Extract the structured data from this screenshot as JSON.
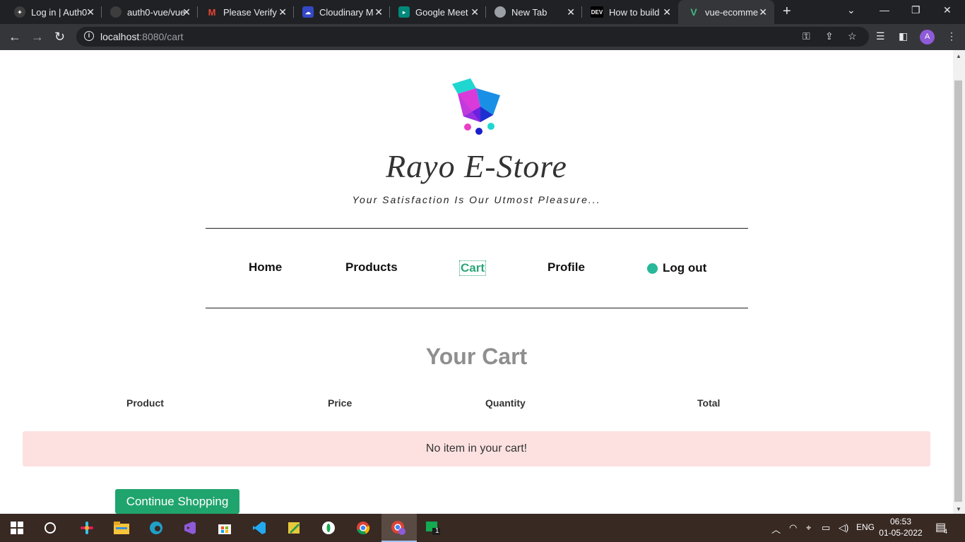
{
  "browser": {
    "tabs": [
      {
        "title": "Log in | Auth0",
        "icon": "auth0-icon",
        "color": "#3d3d3d",
        "active": false
      },
      {
        "title": "auth0-vue/vue",
        "icon": "github-icon",
        "color": "#3d3d3d",
        "active": false
      },
      {
        "title": "Please Verify",
        "icon": "gmail-icon",
        "color": "#ea4335",
        "active": false
      },
      {
        "title": "Cloudinary M",
        "icon": "cloudinary-icon",
        "color": "#3448c5",
        "active": false
      },
      {
        "title": "Google Meet",
        "icon": "google-meet-icon",
        "color": "#00897b",
        "active": false
      },
      {
        "title": "New Tab",
        "icon": "chrome-icon",
        "color": "#9aa0a6",
        "active": false
      },
      {
        "title": "How to build",
        "icon": "dev-icon",
        "color": "#000000",
        "active": false
      },
      {
        "title": "vue-ecommerce",
        "icon": "vue-icon",
        "color": "#41b883",
        "active": true
      }
    ],
    "new_tab_label": "+",
    "url_host": "localhost",
    "url_path": ":8080/cart",
    "profile_initial": "A"
  },
  "site": {
    "title": "Rayo E-Store",
    "tagline": "Your Satisfaction Is Our Utmost Pleasure...",
    "nav": {
      "home": "Home",
      "products": "Products",
      "cart": "Cart",
      "profile": "Profile",
      "logout": "Log out"
    },
    "cart": {
      "heading": "Your Cart",
      "columns": [
        "Product",
        "Price",
        "Quantity",
        "Total"
      ],
      "empty_message": "No item in your cart!",
      "continue_label": "Continue Shopping"
    },
    "colors": {
      "accent": "#20a46d",
      "empty_bg": "#fde1e1",
      "heading": "#8f8f8f"
    }
  },
  "taskbar": {
    "language": "ENG",
    "time": "06:53",
    "date": "01-05-2022",
    "notification_count": "4",
    "badge_count": "1"
  }
}
